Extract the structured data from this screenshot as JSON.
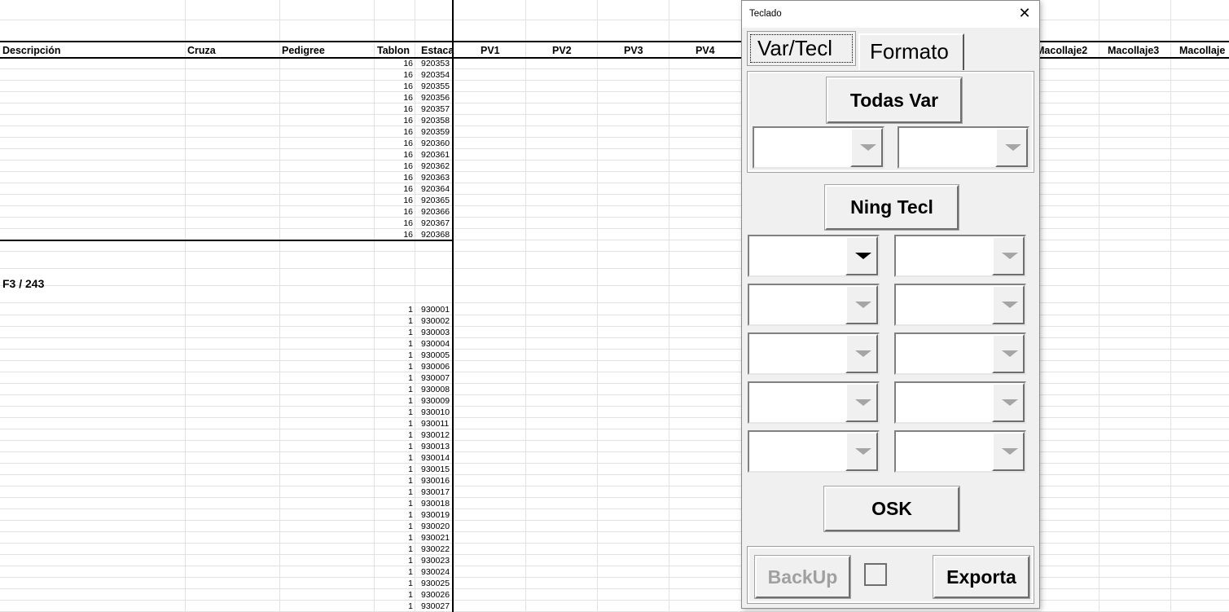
{
  "sheet": {
    "headers": {
      "descripcion": "Descripción",
      "cruza": "Cruza",
      "pedigree": "Pedigree",
      "tablon": "Tablon",
      "estaca": "Estaca",
      "pv1": "PV1",
      "pv2": "PV2",
      "pv3": "PV3",
      "pv4": "PV4",
      "macollaje2": "Macollaje2",
      "macollaje3": "Macollaje3",
      "macollaje": "Macollaje"
    },
    "group1": {
      "tablon": "16",
      "estacas": [
        "920353",
        "920354",
        "920355",
        "920356",
        "920357",
        "920358",
        "920359",
        "920360",
        "920361",
        "920362",
        "920363",
        "920364",
        "920365",
        "920366",
        "920367",
        "920368"
      ]
    },
    "section_title": "F3 / 243",
    "group2": {
      "tablon": "1",
      "estacas": [
        "930001",
        "930002",
        "930003",
        "930004",
        "930005",
        "930006",
        "930007",
        "930008",
        "930009",
        "930010",
        "930011",
        "930012",
        "930013",
        "930014",
        "930015",
        "930016",
        "930017",
        "930018",
        "930019",
        "930020",
        "930021",
        "930022",
        "930023",
        "930024",
        "930025",
        "930026",
        "930027"
      ]
    }
  },
  "dialog": {
    "title": "Teclado",
    "close_glyph": "✕",
    "tabs": {
      "var_tecl": "Var/Tecl",
      "formato": "Formato"
    },
    "buttons": {
      "todas_var": "Todas Var",
      "ning_tecl": "Ning Tecl",
      "osk": "OSK",
      "backup": "BackUp",
      "exporta": "Exporta"
    },
    "colors": {
      "disabled_text": "#a0a0a0",
      "face": "#f0f0f0"
    },
    "icons": {
      "combo_arrow": "chevron-down-icon",
      "close": "close-icon"
    }
  }
}
